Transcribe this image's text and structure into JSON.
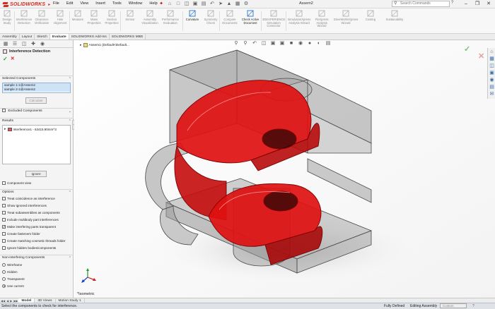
{
  "titlebar": {
    "app_name": "SOLIDWORKS",
    "menus": [
      "File",
      "Edit",
      "View",
      "Insert",
      "Tools",
      "Window",
      "Help"
    ],
    "document_title": "Assem2",
    "search_placeholder": "Search Commands"
  },
  "ribbon": {
    "tools": [
      {
        "label": "Design\nStudy",
        "icon": "design-study-icon"
      },
      {
        "label": "Interference\nDetection",
        "icon": "interference-icon"
      },
      {
        "label": "Clearance\nVerification",
        "icon": "clearance-icon"
      },
      {
        "label": "Hole\nAlignment",
        "icon": "hole-alignment-icon"
      },
      {
        "label": "Measure",
        "icon": "measure-icon"
      },
      {
        "label": "Mass\nProperties",
        "icon": "mass-properties-icon"
      },
      {
        "label": "Section\nProperties",
        "icon": "section-properties-icon"
      },
      {
        "label": "Sensor",
        "icon": "sensor-icon"
      },
      {
        "label": "Assembly\nVisualization",
        "icon": "assembly-visualization-icon"
      },
      {
        "label": "Performance\nEvaluation",
        "icon": "performance-icon"
      },
      {
        "label": "Curvature",
        "icon": "curvature-icon"
      },
      {
        "label": "Symmetry\nCheck",
        "icon": "symmetry-icon"
      },
      {
        "label": "Compare\nDocuments",
        "icon": "compare-icon"
      },
      {
        "label": "Check Active\nDocument",
        "icon": "check-icon"
      },
      {
        "label": "3DEXPERIENCE\nSimulation\nConnector",
        "icon": "simulation-connector-icon"
      },
      {
        "label": "SimulationXpress\nAnalysis Wizard",
        "icon": "simxpress-icon"
      },
      {
        "label": "FloXpress\nAnalysis\nWizard",
        "icon": "floxpress-icon"
      },
      {
        "label": "DriveWorksXpress\nWizard",
        "icon": "driveworks-icon"
      },
      {
        "label": "Costing",
        "icon": "costing-icon"
      },
      {
        "label": "Sustainability",
        "icon": "sustainability-icon"
      }
    ]
  },
  "command_tabs": [
    "Assembly",
    "Layout",
    "Sketch",
    "Evaluate",
    "SOLIDWORKS Add-Ins",
    "SOLIDWORKS MBD"
  ],
  "active_command_tab": "Evaluate",
  "property_manager": {
    "title": "Interference Detection",
    "selected_components_header": "Selected Components",
    "selected_components": [
      "sample 1-1@Assem2",
      "sample 2-1@Assem2"
    ],
    "calculate_label": "Calculate",
    "excluded_components_label": "Excluded Components",
    "results_header": "Results",
    "result_item": "Interference1 - 63415.90mm^3",
    "ignore_label": "Ignore",
    "component_view_label": "Component view",
    "options_header": "Options",
    "options": [
      {
        "label": "Treat coincidence as interference",
        "checked": false
      },
      {
        "label": "Show ignored interferences",
        "checked": false
      },
      {
        "label": "Treat subassemblies as components",
        "checked": false
      },
      {
        "label": "Include multibody part interferences",
        "checked": false
      },
      {
        "label": "Make interfering parts transparent",
        "checked": true
      },
      {
        "label": "Create fasteners folder",
        "checked": false
      },
      {
        "label": "Create matching cosmetic threads folder",
        "checked": false
      },
      {
        "label": "Ignore hidden bodies/components",
        "checked": false
      }
    ],
    "non_interfering_header": "Non-interfering Components",
    "display_modes": [
      {
        "label": "Wireframe",
        "selected": false
      },
      {
        "label": "Hidden",
        "selected": false
      },
      {
        "label": "Transparent",
        "selected": false
      },
      {
        "label": "Use current",
        "selected": true
      }
    ]
  },
  "viewport": {
    "tree_root": "Assem1 (Default<Default...",
    "view_label": "*Isometric",
    "interference_color": "#e01010"
  },
  "bottom_tabs": [
    "Model",
    "3D Views",
    "Motion Study 1"
  ],
  "active_bottom_tab": "Model",
  "status": {
    "message": "Select the components to check for interference.",
    "definition": "Fully Defined",
    "mode": "Editing Assembly",
    "custom": "Custom"
  }
}
